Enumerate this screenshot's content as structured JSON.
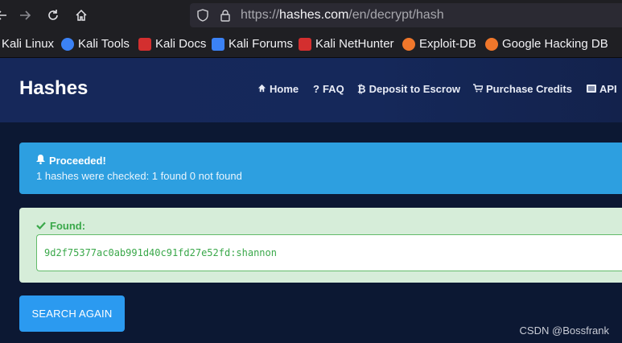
{
  "browser": {
    "url_prefix": "https://",
    "url_host": "hashes.com",
    "url_path": "/en/decrypt/hash"
  },
  "bookmarks": [
    {
      "label": "Kali Linux",
      "icon": "kali-icon"
    },
    {
      "label": "Kali Tools",
      "icon": "kali-tools-icon",
      "color": "#3b82f6"
    },
    {
      "label": "Kali Docs",
      "icon": "kali-docs-icon",
      "color": "#d32f2f"
    },
    {
      "label": "Kali Forums",
      "icon": "kali-forums-icon",
      "color": "#3b82f6"
    },
    {
      "label": "Kali NetHunter",
      "icon": "kali-nethunter-icon",
      "color": "#d32f2f"
    },
    {
      "label": "Exploit-DB",
      "icon": "exploit-db-icon",
      "color": "#f0772b"
    },
    {
      "label": "Google Hacking DB",
      "icon": "ghdb-icon",
      "color": "#f0772b"
    }
  ],
  "site": {
    "brand": "Hashes",
    "nav": [
      {
        "label": "Home",
        "icon": "home-icon"
      },
      {
        "label": "FAQ",
        "icon": "question-icon"
      },
      {
        "label": "Deposit to Escrow",
        "icon": "bitcoin-icon"
      },
      {
        "label": "Purchase Credits",
        "icon": "cart-icon"
      },
      {
        "label": "API",
        "icon": "api-icon"
      }
    ]
  },
  "result": {
    "info_title": "Proceeded!",
    "info_message": "1 hashes were checked: 1 found 0 not found",
    "found_title": "Found:",
    "found_value": "9d2f75377ac0ab991d40c91fd27e52fd:shannon",
    "search_again_label": "SEARCH AGAIN"
  },
  "watermark": "CSDN @Bossfrank",
  "colors": {
    "info": "#2d9fe0",
    "success_bg": "#d6edd9",
    "success_text": "#3aa84a",
    "button": "#2b9af0",
    "header": "#16285a"
  }
}
